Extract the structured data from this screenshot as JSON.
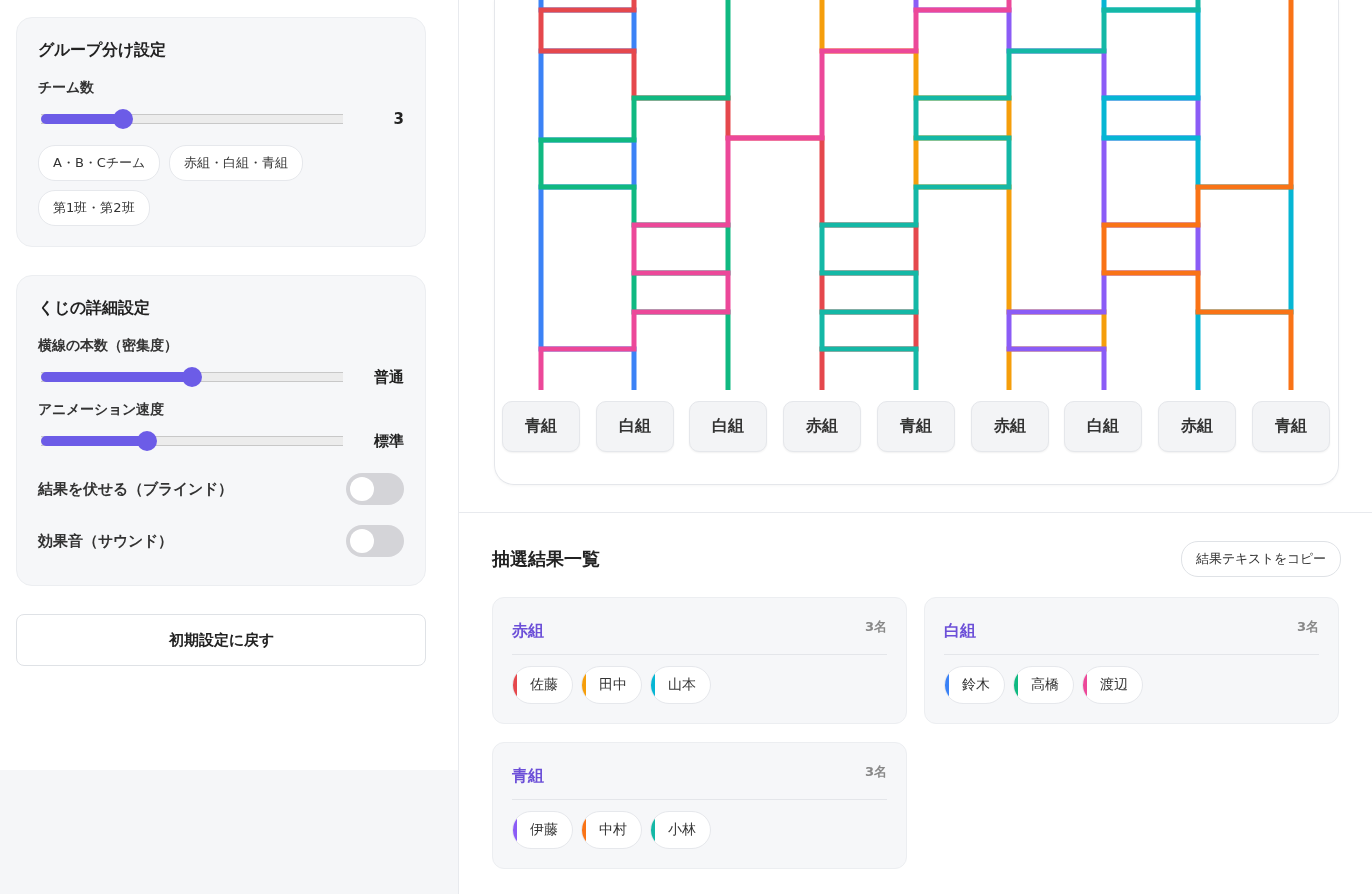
{
  "sidebar": {
    "group_settings": {
      "title": "グループ分け設定",
      "team_count": {
        "label": "チーム数",
        "level": 0.27,
        "value": "3"
      },
      "presets": [
        "A・B・Cチーム",
        "赤組・白組・青組",
        "第1班・第2班"
      ]
    },
    "lottery_settings": {
      "title": "くじの詳細設定",
      "sliders": [
        {
          "label": "横線の本数（密集度）",
          "level": 0.5,
          "value": "普通"
        },
        {
          "label": "アニメーション速度",
          "level": 0.35,
          "value": "標準"
        }
      ],
      "toggles": [
        {
          "label": "結果を伏せる（ブラインド）",
          "on": false
        },
        {
          "label": "効果音（サウンド）",
          "on": false
        }
      ]
    },
    "reset_button": "初期設定に戻す"
  },
  "ladder": {
    "results": [
      "青組",
      "白組",
      "白組",
      "赤組",
      "青組",
      "赤組",
      "白組",
      "赤組",
      "青組"
    ]
  },
  "results": {
    "title": "抽選結果一覧",
    "copy_button": "結果テキストをコピー",
    "teams": [
      {
        "name": "赤組",
        "count": "3名",
        "members": [
          {
            "name": "佐藤",
            "color": "#e5484d"
          },
          {
            "name": "田中",
            "color": "#f59e0b"
          },
          {
            "name": "山本",
            "color": "#06b6d4"
          }
        ]
      },
      {
        "name": "白組",
        "count": "3名",
        "members": [
          {
            "name": "鈴木",
            "color": "#3b82f6"
          },
          {
            "name": "高橋",
            "color": "#10b981"
          },
          {
            "name": "渡辺",
            "color": "#ec4899"
          }
        ]
      },
      {
        "name": "青組",
        "count": "3名",
        "members": [
          {
            "name": "伊藤",
            "color": "#8b5cf6"
          },
          {
            "name": "中村",
            "color": "#f97316"
          },
          {
            "name": "小林",
            "color": "#14b8a6"
          }
        ]
      }
    ]
  }
}
